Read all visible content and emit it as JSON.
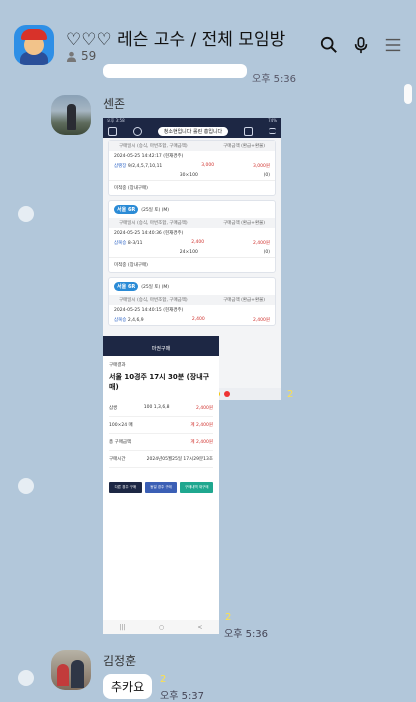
{
  "window": {
    "controls": [
      "–",
      "□",
      "×"
    ]
  },
  "header": {
    "title": "♡♡♡ 레슨 고수 / 전체 모임방",
    "member_count": "59"
  },
  "previous": {
    "time": "오후 5:36"
  },
  "messages": [
    {
      "sender": "센존",
      "screenshot1": {
        "pill": "청소현입니다 롤린 흥입니다",
        "header_cols": [
          "구매일시 (승식, 마번조합, 구매금액)",
          "구매금액 (환급+환불)"
        ],
        "cards": [
          {
            "badge": "",
            "title": "",
            "datetime": "2024-05-25 14:42:17 (현재경주)",
            "type": "삼땡장",
            "numbers": "9/2,4,5,7,10,11",
            "amount": "3,000",
            "refund": "3,000원",
            "refund_sub": "(0)",
            "sub": "30×100",
            "footer": "미적중 (장내구매)"
          },
          {
            "badge": "서울 6R",
            "title": "(25일 토) (M)",
            "datetime": "2024-05-25 14:40:36 (현재경주)",
            "type": "삼복승",
            "numbers": "8-3/11",
            "amount": "2,400",
            "refund": "2,400원",
            "refund_sub": "(0)",
            "sub": "24×100",
            "footer": "미적중 (장내구매)"
          },
          {
            "badge": "서울 6R",
            "title": "(25일 토) (M)",
            "datetime": "2024-05-25 14:40:15 (현재경주)",
            "type": "삼복승",
            "numbers": "2,4,6,9",
            "amount": "2,400",
            "refund": "2,400원",
            "refund_sub": "",
            "sub": "",
            "footer": ""
          }
        ],
        "unread": "2"
      },
      "screenshot2": {
        "nav_title": "마권구매",
        "section": "구매결과",
        "title": "서울 10경주 17시 30분 (장내구매)",
        "rows": [
          {
            "label": "삼쌍",
            "mid": "100  1,3,6,8",
            "value": "2,400원"
          },
          {
            "label": "100×24 매",
            "mid": "",
            "value": "계 2,400원"
          },
          {
            "label": "총 구매금액",
            "mid": "",
            "value": "계 2,400원"
          },
          {
            "label": "구매시간",
            "mid": "",
            "value": "2024년05월25일 17시29분13초"
          }
        ],
        "buttons": [
          "다른 경주 구매",
          "동일 경주 구매",
          "구매내역 재구매"
        ],
        "unread": "2"
      },
      "time": "오후 5:36"
    },
    {
      "sender": "김정훈",
      "text": "추카요",
      "unread": "2",
      "time": "오후 5:37"
    }
  ],
  "colors": {
    "background": "#b2c7da",
    "bubble": "#ffffff",
    "unread": "#ffe14a",
    "phone_nav": "#1d2744"
  }
}
